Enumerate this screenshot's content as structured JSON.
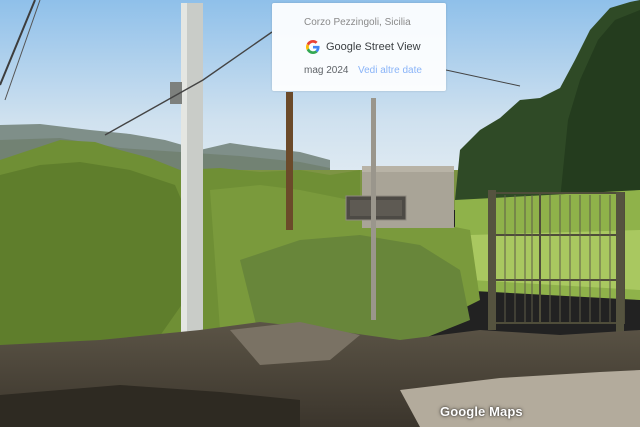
{
  "info_card": {
    "place_name": "Corzo Pezzingoli, Sicilia",
    "product_name": "Google Street View",
    "capture_date": "mag 2024",
    "more_dates_link": "Vedi altre date",
    "logo_icon": "google-g-logo-icon"
  },
  "watermark": {
    "text": "Google Maps"
  },
  "colors": {
    "sky_top": "#8fc0ea",
    "sky_bottom": "#dde9f2",
    "vegetation": "#6f8f35",
    "link": "#8ab4f8"
  }
}
